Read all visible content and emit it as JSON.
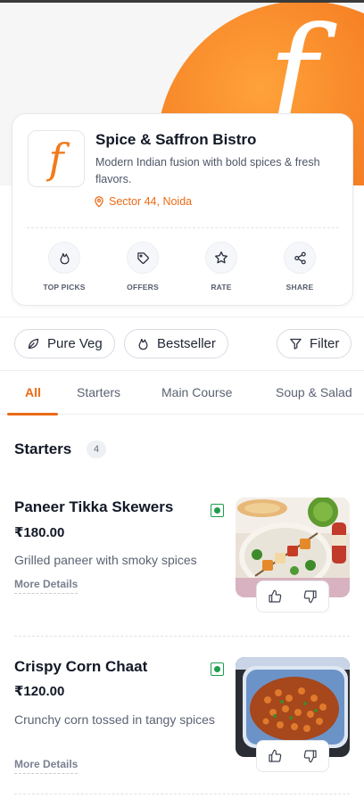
{
  "restaurant": {
    "logo_glyph": "f",
    "name": "Spice & Saffron Bistro",
    "description": "Modern Indian fusion with bold spices & fresh flavors.",
    "location": "Sector 44, Noida",
    "accent_color": "#ec6a15"
  },
  "actions": [
    {
      "label": "TOP PICKS",
      "icon": "flame-icon"
    },
    {
      "label": "OFFERS",
      "icon": "tag-icon"
    },
    {
      "label": "RATE",
      "icon": "star-icon"
    },
    {
      "label": "SHARE",
      "icon": "share-icon"
    }
  ],
  "filters": {
    "pure_veg": "Pure Veg",
    "bestseller": "Bestseller",
    "filter": "Filter"
  },
  "tabs": [
    "All",
    "Starters",
    "Main Course",
    "Soup & Salad"
  ],
  "active_tab": "All",
  "section": {
    "title": "Starters",
    "count": "4"
  },
  "items": [
    {
      "name": "Paneer Tikka Skewers",
      "price": "₹180.00",
      "description": "Grilled paneer with smoky spices",
      "more": "More Details",
      "veg": true
    },
    {
      "name": "Crispy Corn Chaat",
      "price": "₹120.00",
      "description": "Crunchy corn tossed in tangy spices",
      "more": "More Details",
      "veg": true
    }
  ]
}
